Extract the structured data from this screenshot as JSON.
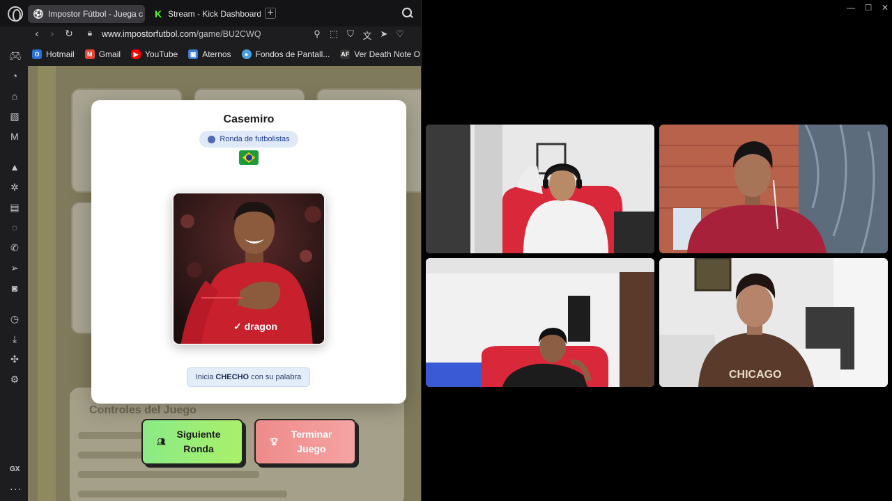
{
  "browser": {
    "tabs": [
      {
        "label": "Impostor Fútbol - Juega c",
        "favicon": "soccer-ball-icon",
        "active": true
      },
      {
        "label": "Stream - Kick Dashboard",
        "favicon": "kick-icon",
        "active": false
      }
    ],
    "address": {
      "host": "www.impostorfutbol.com",
      "path": "/game/BU2CWQ"
    },
    "bookmarks": [
      {
        "label": "Hotmail",
        "icon": "outlook-icon",
        "color": "#2a6fd6"
      },
      {
        "label": "Gmail",
        "icon": "gmail-icon",
        "color": "#ea4335"
      },
      {
        "label": "YouTube",
        "icon": "youtube-icon",
        "color": "#ff0000"
      },
      {
        "label": "Aternos",
        "icon": "aternos-icon",
        "color": "#3a7bd5"
      },
      {
        "label": "Fondos de Pantall...",
        "icon": "eye-icon",
        "color": "#4aa3df"
      },
      {
        "label": "Ver Death Note O...",
        "icon": "af-icon",
        "color": "#333333"
      }
    ],
    "sidebar_gx": "GX"
  },
  "game": {
    "player_name": "Casemiro",
    "round_label": "Ronda de futbolistas",
    "flag": "brazil-flag",
    "starter": {
      "prefix": "Inicia",
      "name": "CHECHO",
      "suffix": "con su palabra"
    },
    "next_button": "Siguiente Ronda",
    "end_button": "Terminar Juego",
    "bg_panel_title": "Controles del Juego",
    "shirt_text": "✓ dragon"
  },
  "call": {
    "participants": [
      {
        "id": "p1",
        "wall": "#eeeeee",
        "chair": "#d8283a",
        "shirt": "#f2f2f2",
        "skin": "#b98a66"
      },
      {
        "id": "p2",
        "wall": "#b8624c",
        "chair": "#5c6c7c",
        "shirt": "#a8213a",
        "skin": "#a77458"
      },
      {
        "id": "p3",
        "wall": "#f1f1f1",
        "chair": "#d8283a",
        "shirt": "#1c1c1c",
        "skin": "#8c5f44"
      },
      {
        "id": "p4",
        "wall": "#e9e9e9",
        "chair": "#3a3a3a",
        "shirt": "#5a3a2a",
        "skin": "#b5846a"
      }
    ]
  }
}
